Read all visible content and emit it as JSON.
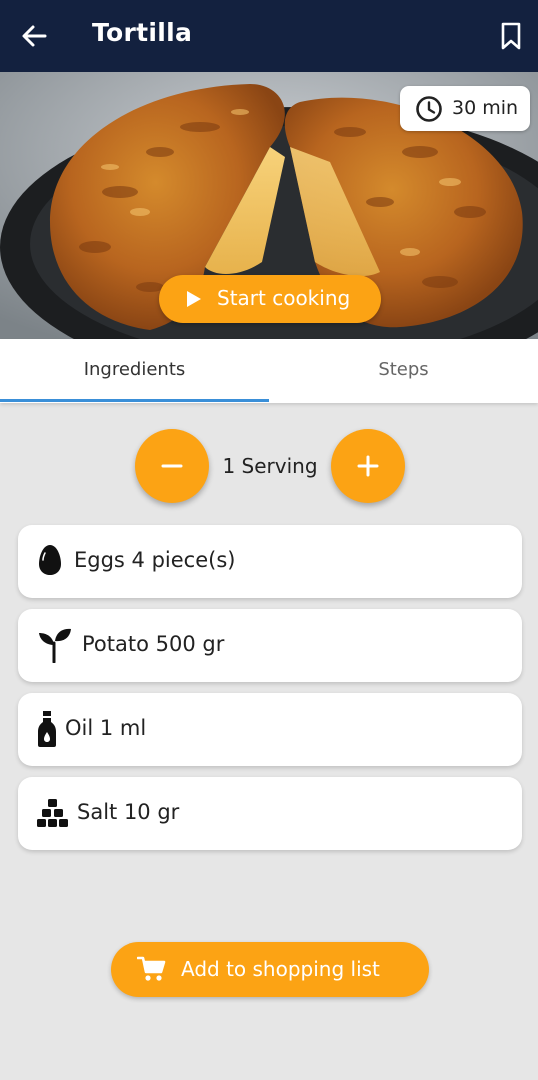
{
  "appbar": {
    "title": "Tortilla",
    "back_icon": "arrow-left-icon",
    "bookmark_icon": "bookmark-icon"
  },
  "hero": {
    "image_subject": "Spanish potato omelette on a dark plate",
    "time_icon": "clock-icon",
    "time": "30 min",
    "start_label": "Start cooking"
  },
  "tabs": [
    {
      "label": "Ingredients",
      "active": true
    },
    {
      "label": "Steps",
      "active": false
    }
  ],
  "servings": {
    "label": "1 Serving",
    "decrease_icon": "minus-icon",
    "increase_icon": "plus-icon"
  },
  "ingredients": [
    {
      "icon": "egg-icon",
      "text": "Eggs 4 piece(s)"
    },
    {
      "icon": "sprout-icon",
      "text": "Potato 500 gr"
    },
    {
      "icon": "oil-bottle-icon",
      "text": "Oil 1 ml"
    },
    {
      "icon": "salt-cubes-icon",
      "text": "Salt 10 gr"
    }
  ],
  "shopping": {
    "icon": "cart-icon",
    "label": "Add to shopping list"
  },
  "colors": {
    "appbar": "#13213f",
    "accent": "#fca314",
    "tab_indicator": "#3a8fd8",
    "background": "#e6e6e6"
  }
}
